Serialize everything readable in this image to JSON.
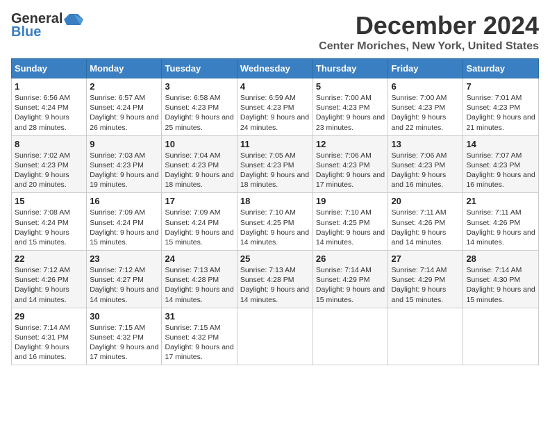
{
  "logo": {
    "line1": "General",
    "line2": "Blue"
  },
  "title": "December 2024",
  "location": "Center Moriches, New York, United States",
  "weekdays": [
    "Sunday",
    "Monday",
    "Tuesday",
    "Wednesday",
    "Thursday",
    "Friday",
    "Saturday"
  ],
  "weeks": [
    [
      {
        "day": "1",
        "sunrise": "6:56 AM",
        "sunset": "4:24 PM",
        "daylight": "9 hours and 28 minutes."
      },
      {
        "day": "2",
        "sunrise": "6:57 AM",
        "sunset": "4:24 PM",
        "daylight": "9 hours and 26 minutes."
      },
      {
        "day": "3",
        "sunrise": "6:58 AM",
        "sunset": "4:23 PM",
        "daylight": "9 hours and 25 minutes."
      },
      {
        "day": "4",
        "sunrise": "6:59 AM",
        "sunset": "4:23 PM",
        "daylight": "9 hours and 24 minutes."
      },
      {
        "day": "5",
        "sunrise": "7:00 AM",
        "sunset": "4:23 PM",
        "daylight": "9 hours and 23 minutes."
      },
      {
        "day": "6",
        "sunrise": "7:00 AM",
        "sunset": "4:23 PM",
        "daylight": "9 hours and 22 minutes."
      },
      {
        "day": "7",
        "sunrise": "7:01 AM",
        "sunset": "4:23 PM",
        "daylight": "9 hours and 21 minutes."
      }
    ],
    [
      {
        "day": "8",
        "sunrise": "7:02 AM",
        "sunset": "4:23 PM",
        "daylight": "9 hours and 20 minutes."
      },
      {
        "day": "9",
        "sunrise": "7:03 AM",
        "sunset": "4:23 PM",
        "daylight": "9 hours and 19 minutes."
      },
      {
        "day": "10",
        "sunrise": "7:04 AM",
        "sunset": "4:23 PM",
        "daylight": "9 hours and 18 minutes."
      },
      {
        "day": "11",
        "sunrise": "7:05 AM",
        "sunset": "4:23 PM",
        "daylight": "9 hours and 18 minutes."
      },
      {
        "day": "12",
        "sunrise": "7:06 AM",
        "sunset": "4:23 PM",
        "daylight": "9 hours and 17 minutes."
      },
      {
        "day": "13",
        "sunrise": "7:06 AM",
        "sunset": "4:23 PM",
        "daylight": "9 hours and 16 minutes."
      },
      {
        "day": "14",
        "sunrise": "7:07 AM",
        "sunset": "4:23 PM",
        "daylight": "9 hours and 16 minutes."
      }
    ],
    [
      {
        "day": "15",
        "sunrise": "7:08 AM",
        "sunset": "4:24 PM",
        "daylight": "9 hours and 15 minutes."
      },
      {
        "day": "16",
        "sunrise": "7:09 AM",
        "sunset": "4:24 PM",
        "daylight": "9 hours and 15 minutes."
      },
      {
        "day": "17",
        "sunrise": "7:09 AM",
        "sunset": "4:24 PM",
        "daylight": "9 hours and 15 minutes."
      },
      {
        "day": "18",
        "sunrise": "7:10 AM",
        "sunset": "4:25 PM",
        "daylight": "9 hours and 14 minutes."
      },
      {
        "day": "19",
        "sunrise": "7:10 AM",
        "sunset": "4:25 PM",
        "daylight": "9 hours and 14 minutes."
      },
      {
        "day": "20",
        "sunrise": "7:11 AM",
        "sunset": "4:26 PM",
        "daylight": "9 hours and 14 minutes."
      },
      {
        "day": "21",
        "sunrise": "7:11 AM",
        "sunset": "4:26 PM",
        "daylight": "9 hours and 14 minutes."
      }
    ],
    [
      {
        "day": "22",
        "sunrise": "7:12 AM",
        "sunset": "4:26 PM",
        "daylight": "9 hours and 14 minutes."
      },
      {
        "day": "23",
        "sunrise": "7:12 AM",
        "sunset": "4:27 PM",
        "daylight": "9 hours and 14 minutes."
      },
      {
        "day": "24",
        "sunrise": "7:13 AM",
        "sunset": "4:28 PM",
        "daylight": "9 hours and 14 minutes."
      },
      {
        "day": "25",
        "sunrise": "7:13 AM",
        "sunset": "4:28 PM",
        "daylight": "9 hours and 14 minutes."
      },
      {
        "day": "26",
        "sunrise": "7:14 AM",
        "sunset": "4:29 PM",
        "daylight": "9 hours and 15 minutes."
      },
      {
        "day": "27",
        "sunrise": "7:14 AM",
        "sunset": "4:29 PM",
        "daylight": "9 hours and 15 minutes."
      },
      {
        "day": "28",
        "sunrise": "7:14 AM",
        "sunset": "4:30 PM",
        "daylight": "9 hours and 15 minutes."
      }
    ],
    [
      {
        "day": "29",
        "sunrise": "7:14 AM",
        "sunset": "4:31 PM",
        "daylight": "9 hours and 16 minutes."
      },
      {
        "day": "30",
        "sunrise": "7:15 AM",
        "sunset": "4:32 PM",
        "daylight": "9 hours and 17 minutes."
      },
      {
        "day": "31",
        "sunrise": "7:15 AM",
        "sunset": "4:32 PM",
        "daylight": "9 hours and 17 minutes."
      },
      null,
      null,
      null,
      null
    ]
  ],
  "labels": {
    "sunrise": "Sunrise:",
    "sunset": "Sunset:",
    "daylight": "Daylight:"
  }
}
